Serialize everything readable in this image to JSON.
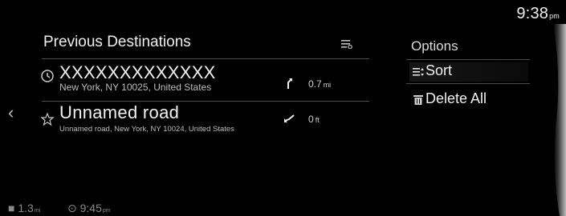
{
  "clock": {
    "time": "9:38",
    "ampm": "pm"
  },
  "panel": {
    "title": "Previous Destinations",
    "filter_icon": "list-filter-icon"
  },
  "destinations": [
    {
      "icon": "history-clock-icon",
      "name": "XXXXXXXXXXXXX",
      "address": "New York, NY 10025, United States",
      "direction_icon": "arrow-up-right-icon",
      "distance": "0.7",
      "distance_unit": "mi"
    },
    {
      "icon": "favorite-star-icon",
      "name": "Unnamed road",
      "address": "Unnamed road, New York, NY 10024, United States",
      "direction_icon": "arrow-down-left-icon",
      "distance": "0",
      "distance_unit": "ft"
    }
  ],
  "options": {
    "title": "Options",
    "items": [
      {
        "label": "Sort",
        "icon": "sort-icon"
      },
      {
        "label": "Delete All",
        "icon": "trash-icon"
      }
    ]
  },
  "status": {
    "distance": "1.3",
    "distance_unit": "mi",
    "eta_time": "9:45",
    "eta_ampm": "pm"
  },
  "colors": {
    "background": "#000000",
    "text": "#e6e6e6",
    "divider": "#4a4a4a",
    "muted": "#8a8a8a"
  }
}
